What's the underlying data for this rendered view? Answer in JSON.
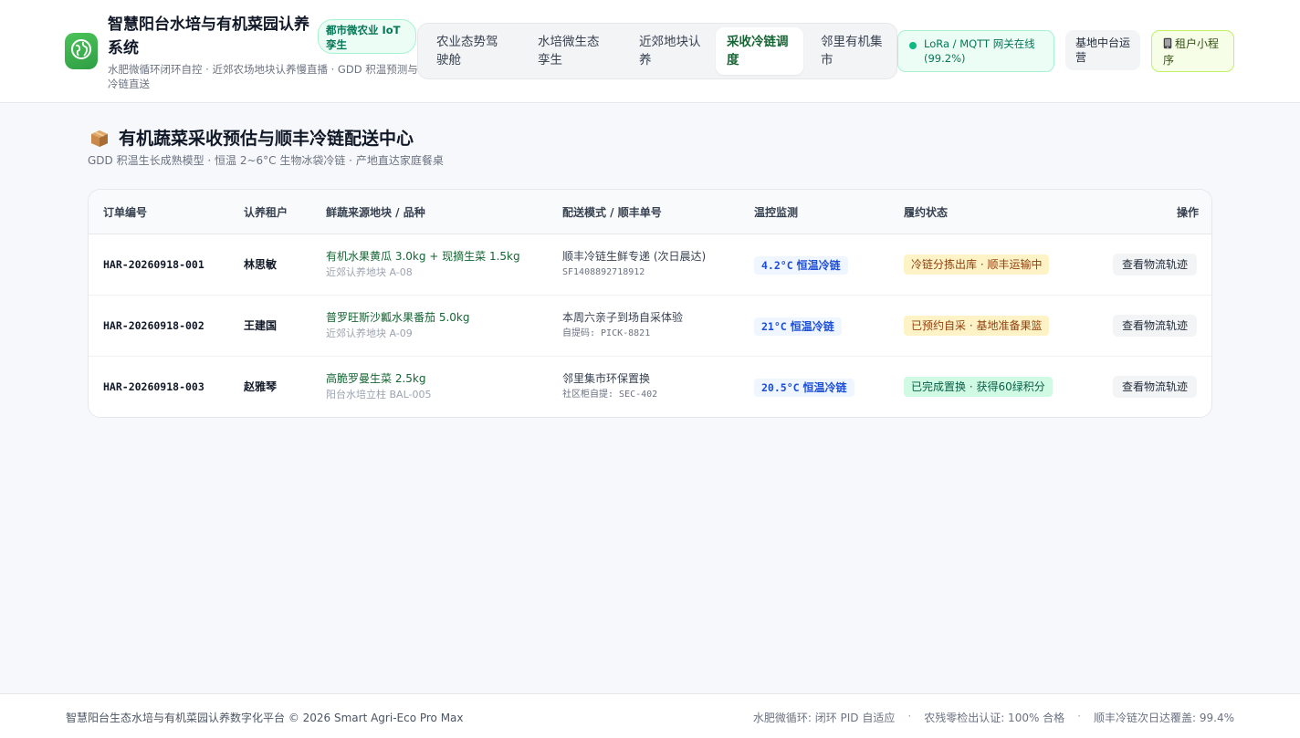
{
  "header": {
    "title": "智慧阳台水培与有机菜园认养系统",
    "subtitle": "水肥微循环闭环自控 · 近郊农场地块认养慢直播 · GDD 积温预测与冷链直送",
    "badge": "都市微农业 IoT 孪生",
    "nav": [
      {
        "label": "农业态势驾驶舱"
      },
      {
        "label": "水培微生态孪生"
      },
      {
        "label": "近郊地块认养"
      },
      {
        "label": "采收冷链调度"
      },
      {
        "label": "邻里有机集市"
      }
    ],
    "gateway_status": "LoRa / MQTT 网关在线 (99.2%)",
    "ops_button": "基地中台运营",
    "mini_program_button": "租户小程序"
  },
  "section": {
    "title": "有机蔬菜采收预估与顺丰冷链配送中心",
    "subtitle": "GDD 积温生长成熟模型 · 恒温 2~6°C 生物冰袋冷链 · 产地直达家庭餐桌"
  },
  "table": {
    "headers": [
      "订单编号",
      "认养租户",
      "鲜蔬来源地块 / 品种",
      "配送模式 / 顺丰单号",
      "温控监测",
      "履约状态",
      "操作"
    ],
    "rows": [
      {
        "order_id": "HAR-20260918-001",
        "tenant": "林思敏",
        "produce": "有机水果黄瓜 3.0kg + 现摘生菜 1.5kg",
        "plot": "近郊认养地块 A-08",
        "delivery": "顺丰冷链生鲜专递 (次日晨达)",
        "tracking": "SF1408892718912",
        "temp": "4.2°C",
        "temp_label": "恒温冷链",
        "status": "冷链分拣出库 · 顺丰运输中",
        "action": "查看物流轨迹"
      },
      {
        "order_id": "HAR-20260918-002",
        "tenant": "王建国",
        "produce": "普罗旺斯沙瓤水果番茄 5.0kg",
        "plot": "近郊认养地块 A-09",
        "delivery": "本周六亲子到场自采体验",
        "tracking": "自提码: PICK-8821",
        "temp": "21°C",
        "temp_label": "恒温冷链",
        "status": "已预约自采 · 基地准备果篮",
        "action": "查看物流轨迹"
      },
      {
        "order_id": "HAR-20260918-003",
        "tenant": "赵雅琴",
        "produce": "高脆罗曼生菜 2.5kg",
        "plot": "阳台水培立柱 BAL-005",
        "delivery": "邻里集市环保置换",
        "tracking": "社区柜自提: SEC-402",
        "temp": "20.5°C",
        "temp_label": "恒温冷链",
        "status": "已完成置换 · 获得60绿积分",
        "action": "查看物流轨迹"
      }
    ]
  },
  "footer": {
    "copyright": "智慧阳台生态水培与有机菜园认养数字化平台 © 2026 Smart Agri-Eco Pro Max",
    "stats": [
      "水肥微循环: 闭环 PID 自适应",
      "农残零检出认证: 100% 合格",
      "顺丰冷链次日达覆盖: 99.4%"
    ]
  },
  "colors": {
    "brand_green": "#2f9e44",
    "accent_blue": "#1d4ed8",
    "status_amber": "#fef3c7",
    "status_green": "#d1fae5"
  }
}
